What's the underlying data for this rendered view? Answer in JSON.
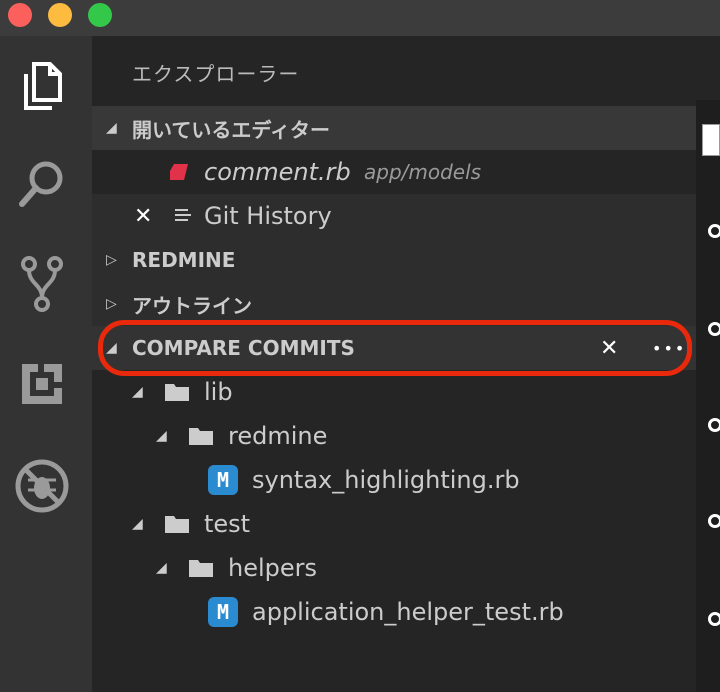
{
  "window": {
    "traffic_lights": [
      "close",
      "minimize",
      "zoom"
    ]
  },
  "activity_bar": {
    "items": [
      "files-icon",
      "search-icon",
      "source-control-icon",
      "extensions-icon",
      "debug-icon"
    ]
  },
  "explorer": {
    "title": "エクスプローラー"
  },
  "open_editors": {
    "header": "開いているエディター",
    "items": [
      {
        "name": "comment.rb",
        "path": "app/models",
        "icon": "ruby-icon"
      },
      {
        "name": "Git History",
        "icon": "list-icon",
        "close": "✕"
      }
    ]
  },
  "sections": {
    "redmine": "REDMINE",
    "outline": "アウトライン",
    "compare_commits": "COMPARE COMMITS",
    "close_glyph": "✕",
    "more_glyph": "•••"
  },
  "compare_tree": [
    {
      "label": "lib",
      "type": "folder",
      "level": 0
    },
    {
      "label": "redmine",
      "type": "folder",
      "level": 1
    },
    {
      "label": "syntax_highlighting.rb",
      "type": "file",
      "level": 2,
      "status": "M"
    },
    {
      "label": "test",
      "type": "folder",
      "level": 0
    },
    {
      "label": "helpers",
      "type": "folder",
      "level": 1
    },
    {
      "label": "application_helper_test.rb",
      "type": "file",
      "level": 2,
      "status": "M"
    }
  ],
  "colors": {
    "highlight": "#e8290c",
    "modified_badge": "#2b8bd1",
    "ruby": "#e0334a"
  }
}
